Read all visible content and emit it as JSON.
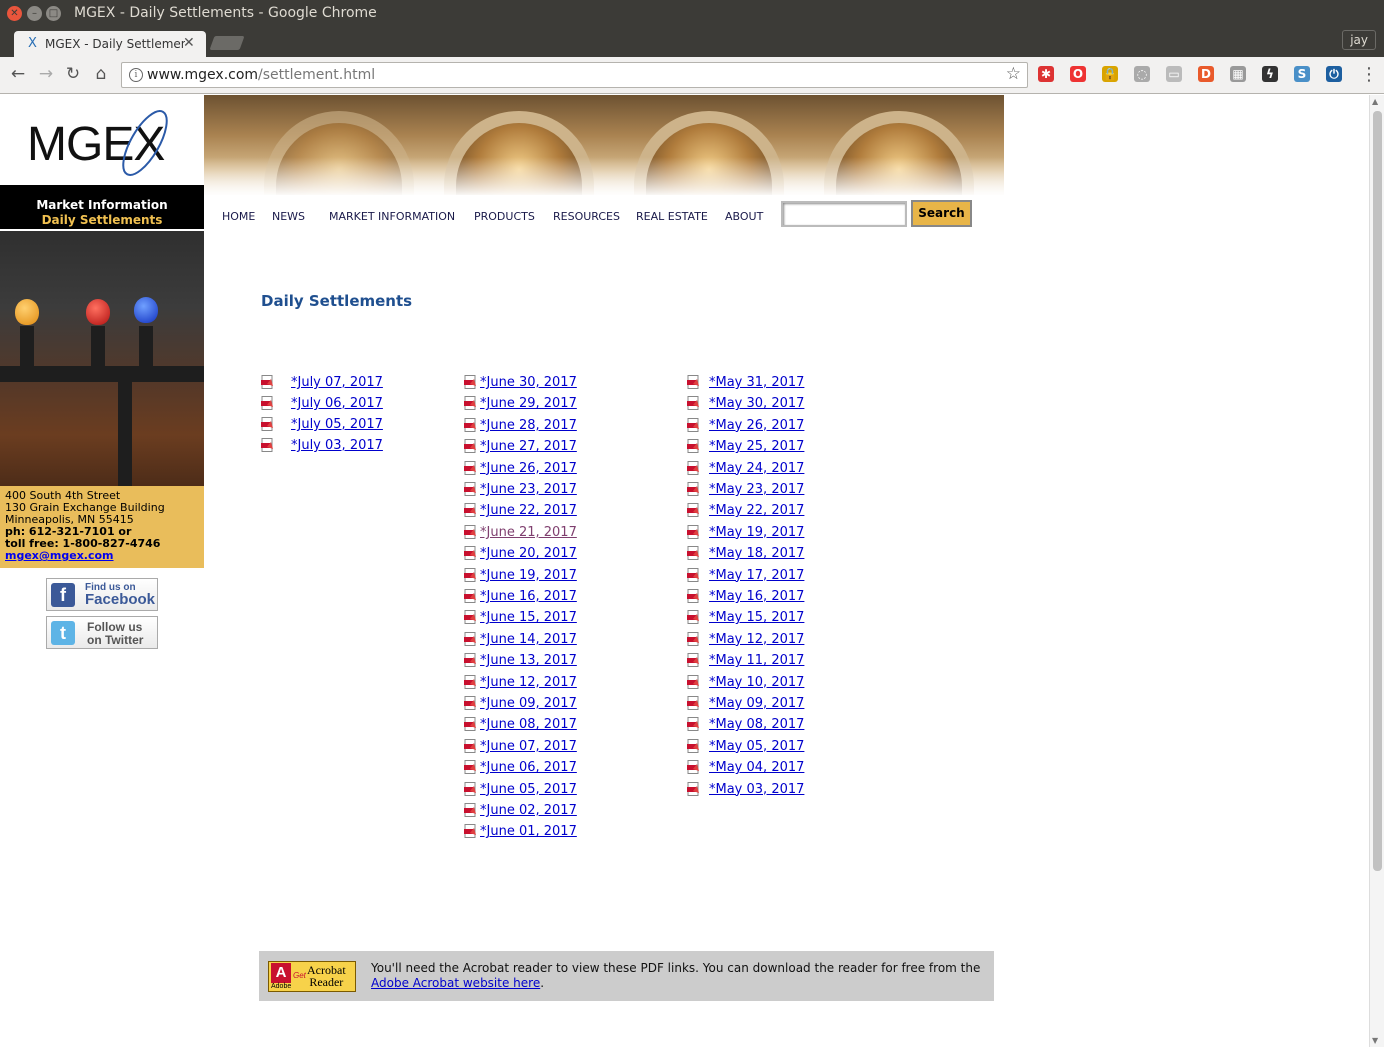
{
  "window": {
    "title": "MGEX - Daily Settlements - Google Chrome"
  },
  "tab": {
    "title": "MGEX - Daily Settlements",
    "favicon": "x-icon"
  },
  "profile": {
    "name": "jay"
  },
  "omnibox": {
    "host": "www.mgex.com",
    "path": "/settlement.html"
  },
  "extensions": [
    {
      "name": "ladybug-icon",
      "glyph": "✱",
      "color": "#d33"
    },
    {
      "name": "opera-icon",
      "glyph": "O",
      "color": "#e33"
    },
    {
      "name": "lock-icon",
      "glyph": "🔒",
      "color": "#d9a400"
    },
    {
      "name": "cast-icon",
      "glyph": "◌",
      "color": "#aaa"
    },
    {
      "name": "extension-icon",
      "glyph": "▭",
      "color": "#bbb"
    },
    {
      "name": "duckduckgo-icon",
      "glyph": "D",
      "color": "#e95a2b"
    },
    {
      "name": "grid-icon",
      "glyph": "▦",
      "color": "#999"
    },
    {
      "name": "lightning-icon",
      "glyph": "ϟ",
      "color": "#333"
    },
    {
      "name": "s-icon",
      "glyph": "S",
      "color": "#4a90c8"
    },
    {
      "name": "power-icon",
      "glyph": "⏻",
      "color": "#1d5fa0"
    }
  ],
  "sidebar": {
    "logo": "MGEX",
    "section_title": "Market Information",
    "section_sub": "Daily Settlements",
    "address": {
      "line1": "400 South 4th Street",
      "line2": "130 Grain Exchange Building",
      "line3": "Minneapolis, MN 55415",
      "phone": "ph: 612-321-7101 or",
      "tollfree": "toll free: 1-800-827-4746",
      "email": "mgex@mgex.com"
    },
    "facebook": {
      "small": "Find us on",
      "big": "Facebook"
    },
    "twitter": {
      "line1": "Follow us",
      "line2": "on Twitter"
    }
  },
  "nav": {
    "items": [
      "HOME",
      "NEWS",
      "MARKET INFORMATION",
      "PRODUCTS",
      "RESOURCES",
      "REAL ESTATE",
      "ABOUT"
    ],
    "search_label": "Search"
  },
  "content": {
    "title": "Daily Settlements",
    "columns": [
      [
        "*July 07, 2017",
        "*July 06, 2017",
        "*July 05, 2017",
        "*July 03, 2017"
      ],
      [
        "*June 30, 2017",
        "*June 29, 2017",
        "*June 28, 2017",
        "*June 27, 2017",
        "*June 26, 2017",
        "*June 23, 2017",
        "*June 22, 2017",
        "*June 21, 2017",
        "*June 20, 2017",
        "*June 19, 2017",
        "*June 16, 2017",
        "*June 15, 2017",
        "*June 14, 2017",
        "*June 13, 2017",
        "*June 12, 2017",
        "*June 09, 2017",
        "*June 08, 2017",
        "*June 07, 2017",
        "*June 06, 2017",
        "*June 05, 2017",
        "*June 02, 2017",
        "*June 01, 2017"
      ],
      [
        "*May 31, 2017",
        "*May 30, 2017",
        "*May 26, 2017",
        "*May 25, 2017",
        "*May 24, 2017",
        "*May 23, 2017",
        "*May 22, 2017",
        "*May 19, 2017",
        "*May 18, 2017",
        "*May 17, 2017",
        "*May 16, 2017",
        "*May 15, 2017",
        "*May 12, 2017",
        "*May 11, 2017",
        "*May 10, 2017",
        "*May 09, 2017",
        "*May 08, 2017",
        "*May 05, 2017",
        "*May 04, 2017",
        "*May 03, 2017"
      ]
    ],
    "visited": [
      "*June 21, 2017"
    ]
  },
  "acrobat": {
    "badge_adobe": "Adobe",
    "badge_get": "Get",
    "badge_name1": "Acrobat",
    "badge_name2": "Reader",
    "text_before": "You'll need the Acrobat reader to view these PDF links. You can download the reader for free from the ",
    "link_text": "Adobe Acrobat website here",
    "text_after": "."
  }
}
